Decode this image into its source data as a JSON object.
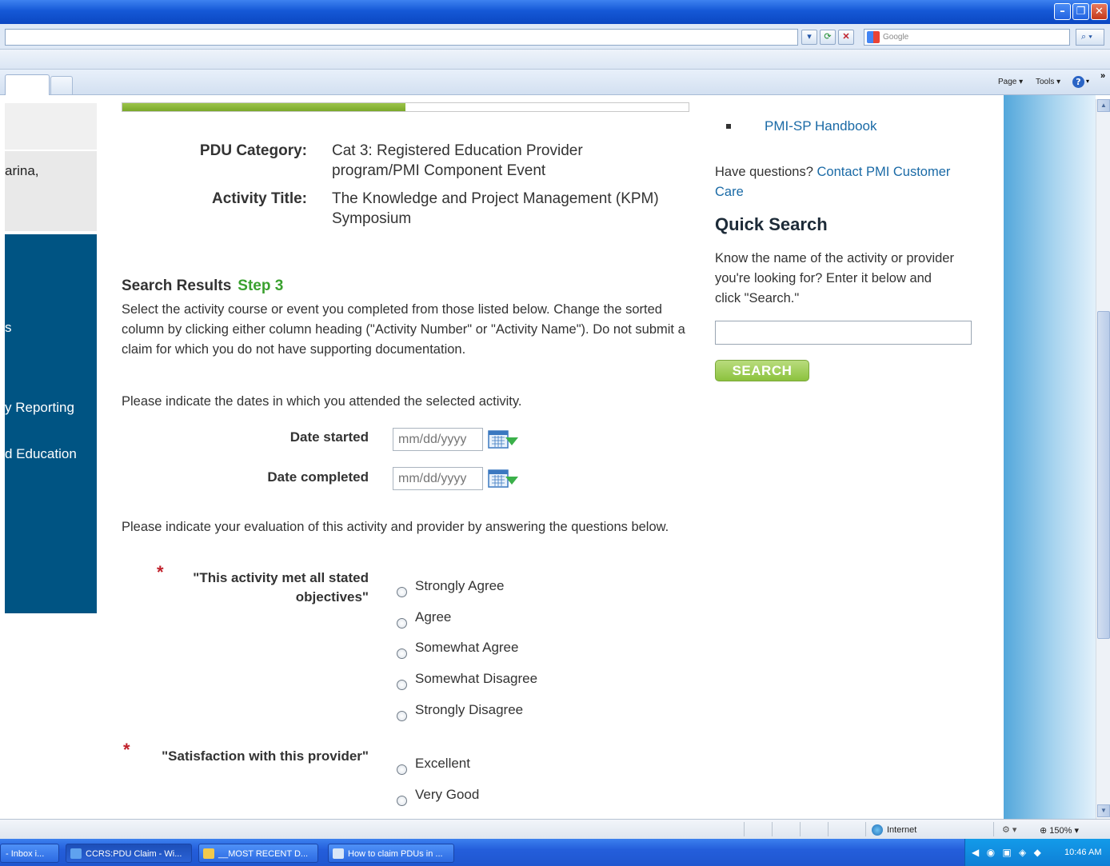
{
  "browser": {
    "search_placeholder": "Google",
    "page_menu": "Page ▾",
    "tools_menu": "Tools ▾",
    "status_zone": "Internet",
    "zoom": "150%",
    "zoom_pct": 150
  },
  "progress": {
    "fraction": 0.5
  },
  "nav": {
    "user_fragment": "arina,",
    "items": [
      "s",
      "y Reporting",
      "d Education"
    ]
  },
  "claim": {
    "pdu_category_label": "PDU Category:",
    "pdu_category_value": "Cat 3: Registered Education Provider program/PMI Component Event",
    "activity_title_label": "Activity Title:",
    "activity_title_value": "The Knowledge and Project Management (KPM) Symposium"
  },
  "search_results": {
    "heading": "Search Results",
    "step": "Step 3",
    "description": "Select the activity course or event you completed from those listed below. Change the sorted column by clicking either column heading (\"Activity Number\" or \"Activity Name\"). Do not submit a claim for which you do not have supporting documentation."
  },
  "dates": {
    "intro": "Please indicate the dates in which you attended the selected activity.",
    "started_label": "Date started",
    "started_placeholder": "mm/dd/yyyy",
    "completed_label": "Date completed",
    "completed_placeholder": "mm/dd/yyyy"
  },
  "evaluation": {
    "intro": "Please indicate your evaluation of this activity and provider by answering the questions below.",
    "required_marker": "*",
    "q1": {
      "label": "\"This activity met all stated objectives\"",
      "options": [
        "Strongly Agree",
        "Agree",
        "Somewhat Agree",
        "Somewhat Disagree",
        "Strongly Disagree"
      ]
    },
    "q2": {
      "label": "\"Satisfaction with this provider\"",
      "options": [
        "Excellent",
        "Very Good"
      ]
    }
  },
  "sidebar": {
    "handbook_link": "PMI-SP Handbook",
    "questions_text": "Have questions?",
    "contact_link": "Contact PMI Customer Care",
    "quick_search_title": "Quick Search",
    "quick_search_desc": "Know the name of the activity or provider you're looking for? Enter it below and click \"Search.\"",
    "search_button": "SEARCH"
  },
  "taskbar": {
    "items": [
      "- Inbox i...",
      "CCRS:PDU Claim - Wi...",
      "__MOST RECENT D...",
      "How to claim PDUs in ..."
    ],
    "clock": "10:46 AM"
  }
}
